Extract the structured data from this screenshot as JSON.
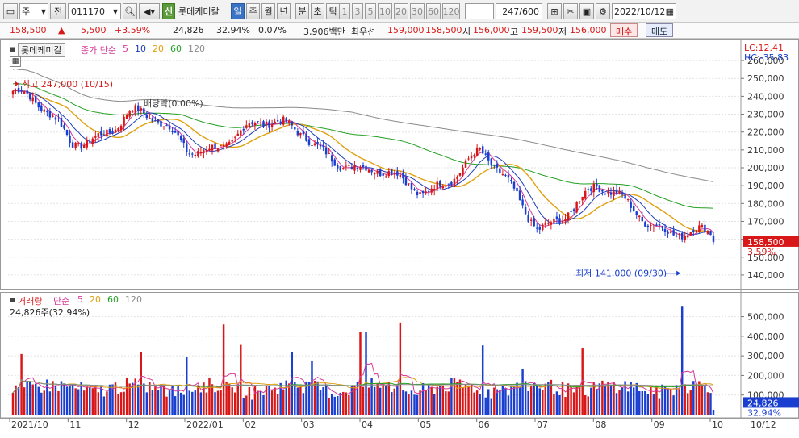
{
  "toolbar": {
    "period_select": "주",
    "prev_label": "전",
    "code": "011170",
    "badge_sin": "신",
    "stock_name": "롯데케미칼",
    "periods": [
      "일",
      "주",
      "월",
      "년",
      "분",
      "초",
      "틱"
    ],
    "active_period": "일",
    "intervals": [
      "1",
      "3",
      "5",
      "10",
      "20",
      "30",
      "60",
      "120"
    ],
    "count": "247",
    "count_total": "/600",
    "date": "2022/10/12"
  },
  "info": {
    "price": "158,500",
    "change": "5,500",
    "change_pct": "+3.59%",
    "volume": "24,826",
    "vol_ratio": "32.94%",
    "turnover": "0.07%",
    "amount": "3,906백만",
    "best_ask_label": "최우선",
    "best_ask": "159,000",
    "best_bid": "158,500",
    "open_label": "시",
    "open": "156,000",
    "high_label": "고",
    "high": "159,500",
    "low_label": "저",
    "low": "156,000",
    "buy_label": "매수",
    "sell_label": "매도"
  },
  "price_pane": {
    "legend_name": "롯데케미칼",
    "legend_ma": "종가 단순",
    "ma_periods": [
      "5",
      "10",
      "20",
      "60",
      "120"
    ],
    "lc": "LC:12.41",
    "hc": "HC:-35.83",
    "high_note": "최고 247,000 (10/15)",
    "div_note": "배당락(0.00%)",
    "low_note": "최저 141,000 (09/30)",
    "cur_price_tag": "158,500",
    "cur_pct_tag": "3.59%",
    "yticks": [
      "260,000",
      "250,000",
      "240,000",
      "230,000",
      "220,000",
      "210,000",
      "200,000",
      "190,000",
      "180,000",
      "170,000",
      "160,000",
      "150,000",
      "140,000"
    ]
  },
  "volume_pane": {
    "legend_name": "거래량",
    "legend_ma": "단순",
    "ma_periods": [
      "5",
      "20",
      "60",
      "120"
    ],
    "cur_label": "24,826주(32.94%)",
    "yticks": [
      "500,000",
      "400,000",
      "300,000",
      "200,000",
      "100,000"
    ],
    "cur_tag": "24,826",
    "cur_pct_tag": "32.94%"
  },
  "xaxis": {
    "labels": [
      "2021/10",
      "11",
      "12",
      "2022/01",
      "02",
      "03",
      "04",
      "05",
      "06",
      "07",
      "08",
      "09",
      "10"
    ],
    "right_label": "10/12"
  },
  "colors": {
    "up": "#d81818",
    "down": "#1a3fd0",
    "ma5": "#d83a9a",
    "ma10": "#1e3cb8",
    "ma20": "#e0a010",
    "ma60": "#23a023",
    "ma120": "#8a8a8a"
  },
  "chart_data": {
    "type": "line",
    "title": "롯데케미칼 (011170) 일봉",
    "x": [
      "2021/10",
      "2021/11",
      "2021/12",
      "2022/01",
      "2022/02",
      "2022/03",
      "2022/04",
      "2022/05",
      "2022/06",
      "2022/07",
      "2022/08",
      "2022/09",
      "2022/10"
    ],
    "series": [
      {
        "name": "종가",
        "values": [
          243000,
          215000,
          230000,
          212000,
          220000,
          222000,
          195000,
          190000,
          205000,
          170000,
          185000,
          172000,
          158500
        ]
      }
    ],
    "ylim": [
      135000,
      265000
    ],
    "volume_ylim": [
      0,
      560000
    ],
    "volume_peak": 555000
  }
}
